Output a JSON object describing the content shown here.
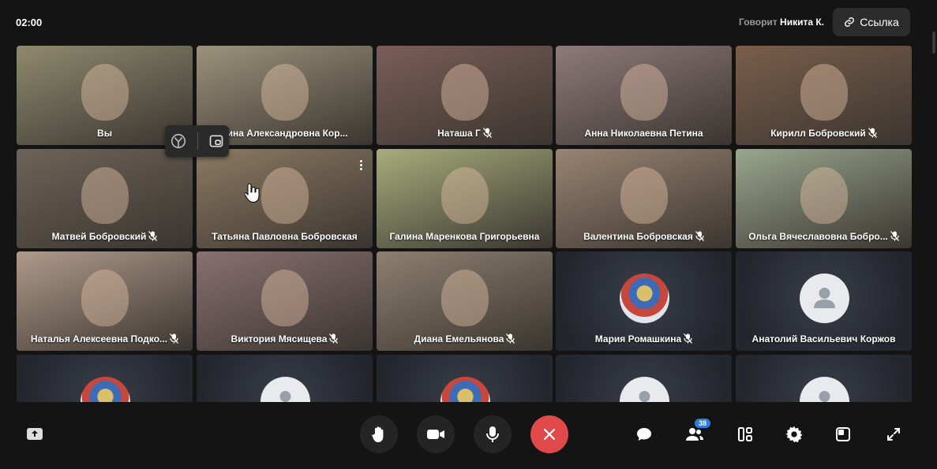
{
  "header": {
    "timer": "02:00",
    "speaking_label": "Говорит",
    "speaker_name": "Никита К.",
    "link_button_label": "Ссылка"
  },
  "participants": [
    {
      "name": "Вы",
      "muted": false,
      "type": "video",
      "bg": "#8f8a6e"
    },
    {
      "name": "нина Александровна Кор...",
      "muted": false,
      "type": "video",
      "bg": "#9c937b"
    },
    {
      "name": "Наташа Г",
      "muted": true,
      "type": "video",
      "bg": "#7b5d58"
    },
    {
      "name": "Анна Николаевна Петина",
      "muted": false,
      "type": "video",
      "bg": "#8e7a7a"
    },
    {
      "name": "Кирилл Бобровский",
      "muted": true,
      "type": "video",
      "bg": "#7a5e4a"
    },
    {
      "name": "Матвей Бобровский",
      "muted": true,
      "type": "video",
      "bg": "#6d6358"
    },
    {
      "name": "Татьяна Павловна Бобровская",
      "muted": false,
      "type": "video",
      "bg": "#8d7a62"
    },
    {
      "name": "Галина Маренкова Григорьевна",
      "muted": false,
      "type": "video",
      "bg": "#a7ad7c"
    },
    {
      "name": "Валентина Бобровская",
      "muted": true,
      "type": "video",
      "bg": "#9a8472"
    },
    {
      "name": "Ольга Вячеславовна Бобро...",
      "muted": true,
      "type": "video",
      "bg": "#9aa68e"
    },
    {
      "name": "Наталья Алексеевна Подко...",
      "muted": true,
      "type": "video",
      "bg": "#b09a8a"
    },
    {
      "name": "Виктория Мясищева",
      "muted": true,
      "type": "video",
      "bg": "#8a7070"
    },
    {
      "name": "Диана Емельянова",
      "muted": true,
      "type": "video",
      "bg": "#8d8070"
    },
    {
      "name": "Мария Ромашкина",
      "muted": true,
      "type": "avatar-photo",
      "bg": "#2a2d36"
    },
    {
      "name": "Анатолий Васильевич Коржов",
      "muted": false,
      "type": "avatar-default",
      "bg": "#2a2d36"
    },
    {
      "name": "",
      "muted": false,
      "type": "avatar-photo",
      "bg": "#2a2d36"
    },
    {
      "name": "",
      "muted": false,
      "type": "avatar-default",
      "bg": "#2a2d36"
    },
    {
      "name": "",
      "muted": false,
      "type": "avatar-photo",
      "bg": "#2a2d36"
    },
    {
      "name": "",
      "muted": false,
      "type": "avatar-default",
      "bg": "#2a2d36"
    },
    {
      "name": "",
      "muted": false,
      "type": "avatar-default",
      "bg": "#2a2d36"
    }
  ],
  "controls": {
    "participants_count": "38",
    "icons": [
      "share-screen-icon",
      "raise-hand-icon",
      "camera-icon",
      "microphone-icon",
      "end-call-icon",
      "chat-icon",
      "participants-icon",
      "layout-icon",
      "settings-icon",
      "pip-icon",
      "fullscreen-icon"
    ],
    "end_color": "#e04a4a",
    "badge_color": "#2d7be5"
  }
}
